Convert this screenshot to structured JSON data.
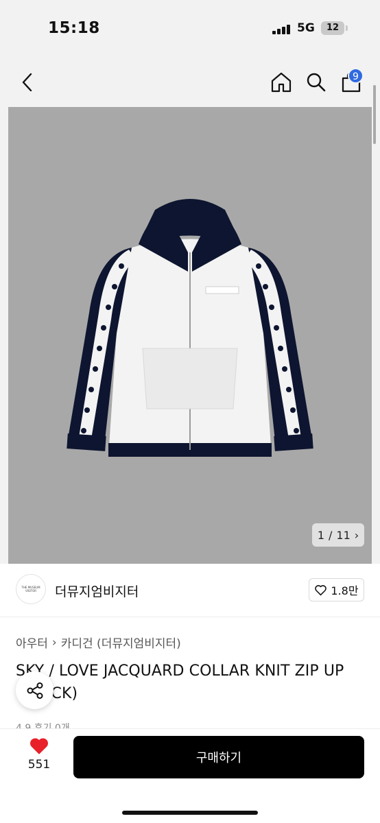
{
  "status_bar": {
    "time": "15:18",
    "network": "5G",
    "battery": "12"
  },
  "nav": {
    "cart_count": "9",
    "icons": [
      "back-arrow-icon",
      "home-icon",
      "search-icon",
      "shopping-bag-icon"
    ]
  },
  "gallery": {
    "current": "1",
    "separator": "/",
    "total": "11",
    "next_glyph": "›"
  },
  "brand": {
    "logo_text": "THE MUSEUM VISITOR",
    "name": "더뮤지엄비지터",
    "likes": "1.8만"
  },
  "product": {
    "breadcrumb": [
      "아우터",
      "카디건 (더뮤지엄비지터)"
    ],
    "breadcrumb_sep": "›",
    "title": "SKY / LOVE JACQUARD COLLAR KNIT ZIP UP (BLACK)",
    "rating_peek": "4.9 후기 0개"
  },
  "bottom_bar": {
    "wish_count": "551",
    "buy_label": "구매하기"
  },
  "colors": {
    "accent": "#2f6ae0",
    "wish_red": "#e8202a",
    "buy_bg": "#000000",
    "photo_bg": "#a8a8a8"
  }
}
